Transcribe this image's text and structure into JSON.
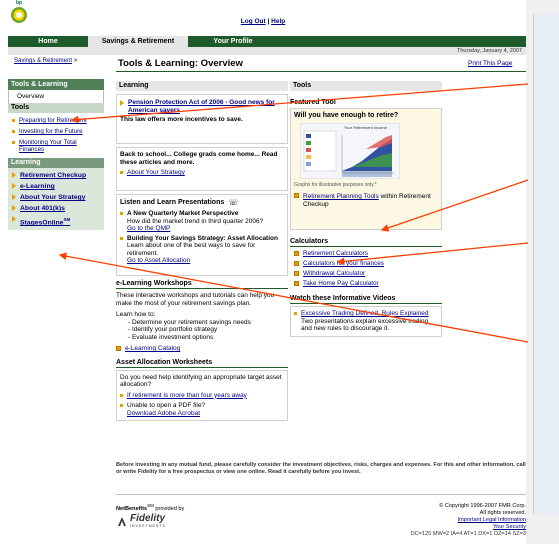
{
  "header": {
    "brand": "bp",
    "logout": "Log Out",
    "separator": "|",
    "help": "Help"
  },
  "nav": {
    "tabs": [
      {
        "label": "Home"
      },
      {
        "label": "Savings & Retirement"
      },
      {
        "label": "Your Profile"
      }
    ],
    "date": "Thursday, January 4, 2007"
  },
  "page": {
    "breadcrumb": "Savings & Retirement",
    "breadcrumb_sep": ">",
    "title": "Tools & Learning: Overview",
    "print": "Print This Page"
  },
  "leftnav": {
    "header": "Tools & Learning",
    "overview": "Overview",
    "tools_head": "Tools",
    "tools": [
      "Preparing for Retirement",
      "Investing for the Future",
      "Monitoring Your Total Finances"
    ],
    "learning_head": "Learning",
    "learning": [
      "Retirement Checkup",
      "e-Learning",
      "About Your Strategy",
      "About 401(k)s"
    ],
    "stages": "StagesOnline",
    "stages_sup": "SM"
  },
  "learning": {
    "head": "Learning",
    "pension_title": "Pension Protection Act of 2006 - Good news for American savers",
    "pension_desc": "This law offers more incentives to save.",
    "school_text": "Back to school... College grads come home... Read these articles and more.",
    "school_link": "About Your Strategy",
    "listen_head": "Listen and Learn Presentations",
    "pres1_title": "A New Quarterly Market Perspective",
    "pres1_desc": "How did the market trend in third quarter 2006?",
    "pres1_link": "Go to the QMP",
    "pres2_title": "Building Your Savings Strategy: Asset Allocation",
    "pres2_desc": "Learn about one of the best ways to save for retirement.",
    "pres2_link": "Go to Asset Allocation",
    "elearn_head": "e-Learning Workshops",
    "elearn_desc": "These interactive workshops and tutorials can help you make the most of your retirement savings plan.",
    "learn_how": "Learn how to:",
    "learn_items": [
      "- Determine your retirement savings needs",
      "- Identify your portfolio strategy",
      "- Evaluate investment options"
    ],
    "catalog": "e-Learning Catalog",
    "asset_head": "Asset Allocation Worksheets",
    "asset_q": "Do you need help identifying an appropriate target asset allocation?",
    "asset_link": "If retirement is more than four years away",
    "pdf_q": "Unable to open a PDF file?",
    "pdf_link": "Download Adobe Acrobat"
  },
  "tools": {
    "head": "Tools",
    "featured_head": "Featured Tool",
    "featured_q": "Will you have enough to retire?",
    "chart_title": "Your Retirement Income",
    "graph_note": "Graphs for illustrative purposes only.*",
    "rpt_link": "Retirement Planning Tools",
    "rpt_text": " within Retirement Checkup",
    "calc_head": "Calculators",
    "calcs": [
      "Retirement Calculators",
      "Calculators for your finances",
      "Withdrawal Calculator",
      "Take Home Pay Calculator"
    ],
    "videos_head": "Watch these Informative Videos",
    "video_link": "Excessive Trading Defined, Rules Explained",
    "video_desc": "Two presentations explain excessive trading and new rules to discourage it."
  },
  "footer": {
    "disclaimer": "Before investing in any mutual fund, please carefully consider the investment objectives, risks, charges and expenses. For this and other information, call or write Fidelity for a free prospectus or view one online. Read it carefully before you invest.",
    "netbenefits": "NetBenefits",
    "netbenefits_sup": "SM",
    "provided_by": " provided by",
    "fidelity": "Fidelity",
    "fidelity_sub": "INVESTMENTS",
    "copyright": "© Copyright 1996-2007 FMR Corp.",
    "rights": "All rights reserved.",
    "legal": "Important Legal Information",
    "security": "Your Security",
    "debug": "DC=125 MW=2 IA=4 AT=1 DX=1 DZ=14 SZ=3"
  },
  "colors": {
    "nav_green": "#1f5a2a",
    "accent_orange": "#e8a000",
    "annotation_arrow": "#ff4000"
  }
}
